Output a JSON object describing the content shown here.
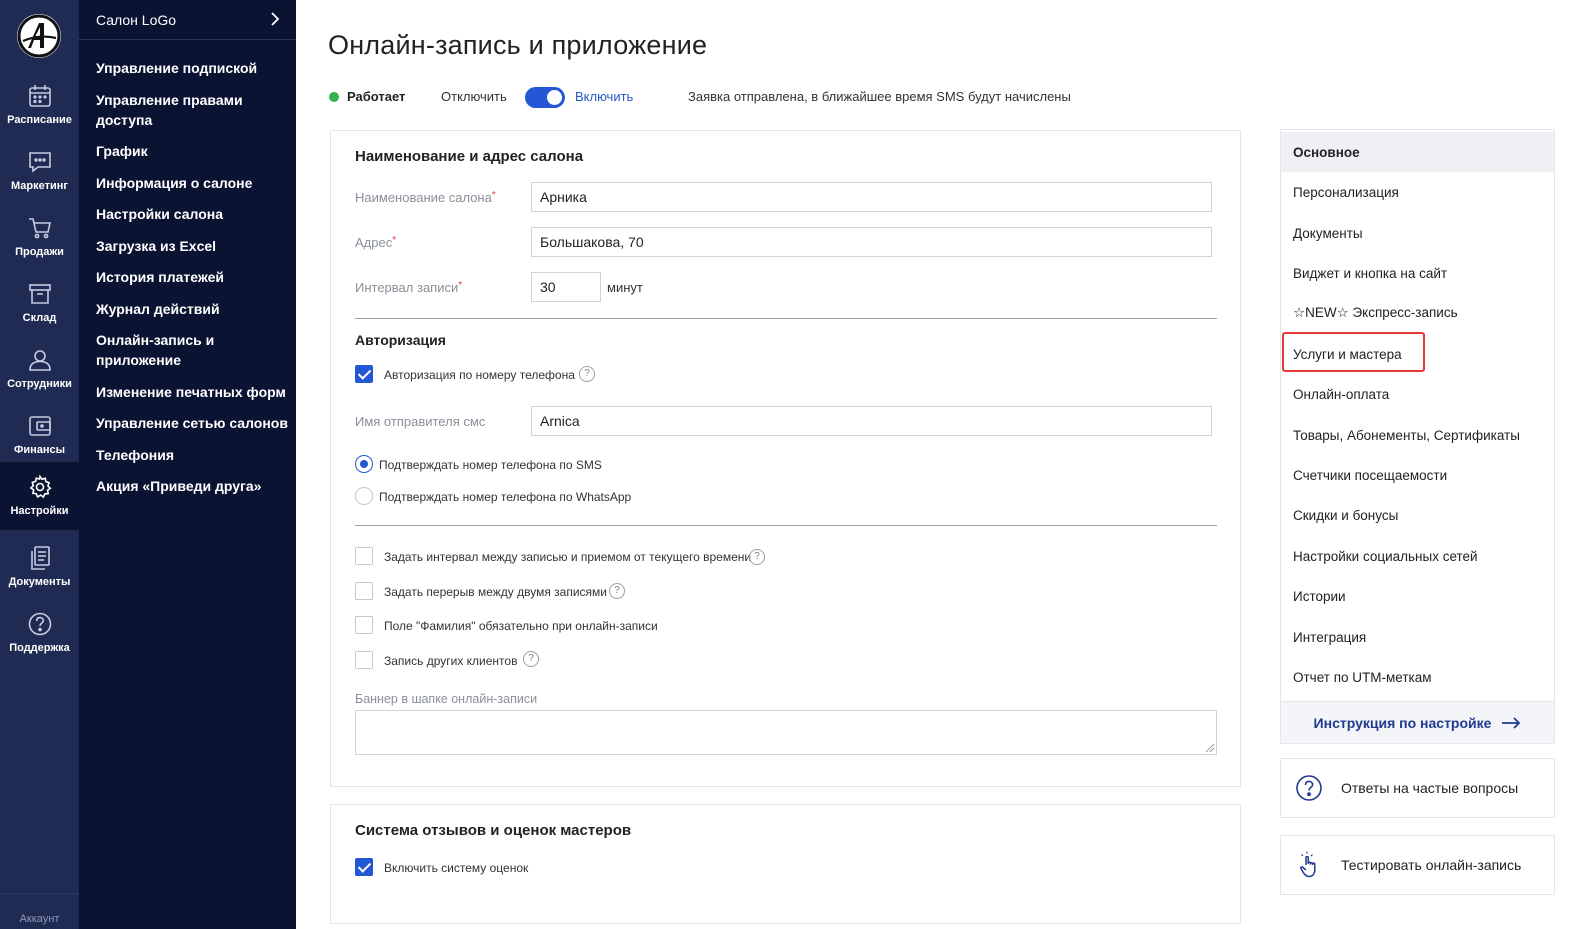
{
  "rail": {
    "items": [
      {
        "label": "Расписание",
        "icon": "calendar-icon"
      },
      {
        "label": "Маркетинг",
        "icon": "chat-icon"
      },
      {
        "label": "Продажи",
        "icon": "cart-icon"
      },
      {
        "label": "Склад",
        "icon": "box-icon"
      },
      {
        "label": "Сотрудники",
        "icon": "user-icon"
      },
      {
        "label": "Финансы",
        "icon": "wallet-icon"
      },
      {
        "label": "Настройки",
        "icon": "gear-icon"
      },
      {
        "label": "Документы",
        "icon": "documents-icon"
      },
      {
        "label": "Поддержка",
        "icon": "help-icon"
      }
    ],
    "active": "Настройки",
    "account": "Аккаунт"
  },
  "menu": {
    "salon": "Салон LoGo",
    "items": [
      "Управление подпиской",
      "Управление правами доступа",
      "График",
      "Информация о салоне",
      "Настройки салона",
      "Загрузка из Excel",
      "История платежей",
      "Журнал действий",
      "Онлайн-запись и приложение",
      "Изменение печатных форм",
      "Управление сетью салонов",
      "Телефония",
      "Акция «Приведи друга»"
    ]
  },
  "page": {
    "title": "Онлайн-запись и приложение",
    "status": "Работает",
    "toggle_off": "Отключить",
    "toggle_on": "Включить",
    "toggle_state": "on",
    "notice": "Заявка отправлена, в ближайшее время SMS будут начислены"
  },
  "salon_form": {
    "section_title": "Наименование и адрес салона",
    "name_label": "Наименование салона",
    "name_value": "Арника",
    "address_label": "Адрес",
    "address_value": "Большакова, 70",
    "interval_label": "Интервал записи",
    "interval_value": "30",
    "interval_unit": "минут",
    "required_mark": "*"
  },
  "auth": {
    "section_title": "Авторизация",
    "phone_auth_label": "Авторизация по номеру телефона",
    "phone_auth_checked": true,
    "sender_label": "Имя отправителя смс",
    "sender_value": "Arnica",
    "confirm_sms": "Подтверждать номер телефона по SMS",
    "confirm_whatsapp": "Подтверждать номер телефона по WhatsApp",
    "confirm_selected": "sms"
  },
  "options": {
    "interval_from_now": "Задать интервал между записью и приемом от текущего времени",
    "break_between": "Задать перерыв между двумя записями",
    "surname_required": "Поле \"Фамилия\" обязательно при онлайн-записи",
    "other_clients": "Запись других клиентов",
    "banner_label": "Баннер в шапке онлайн-записи",
    "help_glyph": "?"
  },
  "reviews": {
    "section_title": "Система отзывов и оценок мастеров",
    "enable_label": "Включить систему оценок",
    "enabled": true
  },
  "right_nav": {
    "items": [
      "Основное",
      "Персонализация",
      "Документы",
      "Виджет и кнопка на сайт",
      "☆NEW☆ Экспресс-запись",
      "Услуги и мастера",
      "Онлайн-оплата",
      "Товары, Абонементы, Сертификаты",
      "Счетчики посещаемости",
      "Скидки и бонусы",
      "Настройки социальных сетей",
      "Истории",
      "Интеграция",
      "Отчет по UTM-меткам"
    ],
    "active": "Основное",
    "highlighted": "Услуги и мастера",
    "highlight_color": "#e53935",
    "footer_link": "Инструкция по настройке"
  },
  "cards": {
    "faq": "Ответы на частые вопросы",
    "test": "Тестировать онлайн-запись"
  },
  "colors": {
    "rail_bg": "#1f2b53",
    "menu_bg": "#0b1332",
    "accent": "#2357d6",
    "status_green": "#33b14c"
  }
}
